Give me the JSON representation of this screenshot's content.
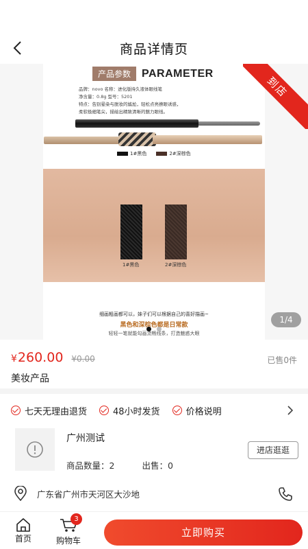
{
  "header": {
    "title": "商品详情页"
  },
  "gallery": {
    "param_tag": "产品参数",
    "param_en": "PARAMETER",
    "param_lines": [
      "品牌：novo  名称：进化版持久液体眼线笔",
      "净含量：0.8g  型号：5201",
      "特点：告别晕染与脱妆的尴尬，轻松点亮撩眼诱惑，",
      "柔软极细笔尖，描绘出精致清晰的魅力眼线。"
    ],
    "color1": "1#黑色",
    "color2": "2#深棕色",
    "caption1": "细画粗画都可以，妹子们可以根据自己的喜好描画~",
    "caption2": "黑色和深棕色都是日常款",
    "caption3": "轻轻一笔就能勾画流畅线条，打造魅惑大眼",
    "ribbon": "到店",
    "page_indicator": "1/4",
    "dots_total": 4,
    "dots_active": 0
  },
  "product": {
    "currency": "¥",
    "price": "260.00",
    "original_price": "¥0.00",
    "sold": "已售0件",
    "name": "美妆产品"
  },
  "services": [
    "七天无理由退货",
    "48小时发货",
    "价格说明"
  ],
  "shop": {
    "name": "广州测试",
    "quantity_label": "商品数量：",
    "quantity": "2",
    "sold_label": "出售：",
    "sold": "0",
    "visit_button": "进店逛逛"
  },
  "address": "广东省广州市天河区大沙地",
  "bottombar": {
    "home_label": "首页",
    "cart_label": "购物车",
    "cart_badge": "3",
    "buy_button": "立即购买"
  },
  "colors": {
    "accent": "#e2261d",
    "ribbon": "#e2261d"
  }
}
